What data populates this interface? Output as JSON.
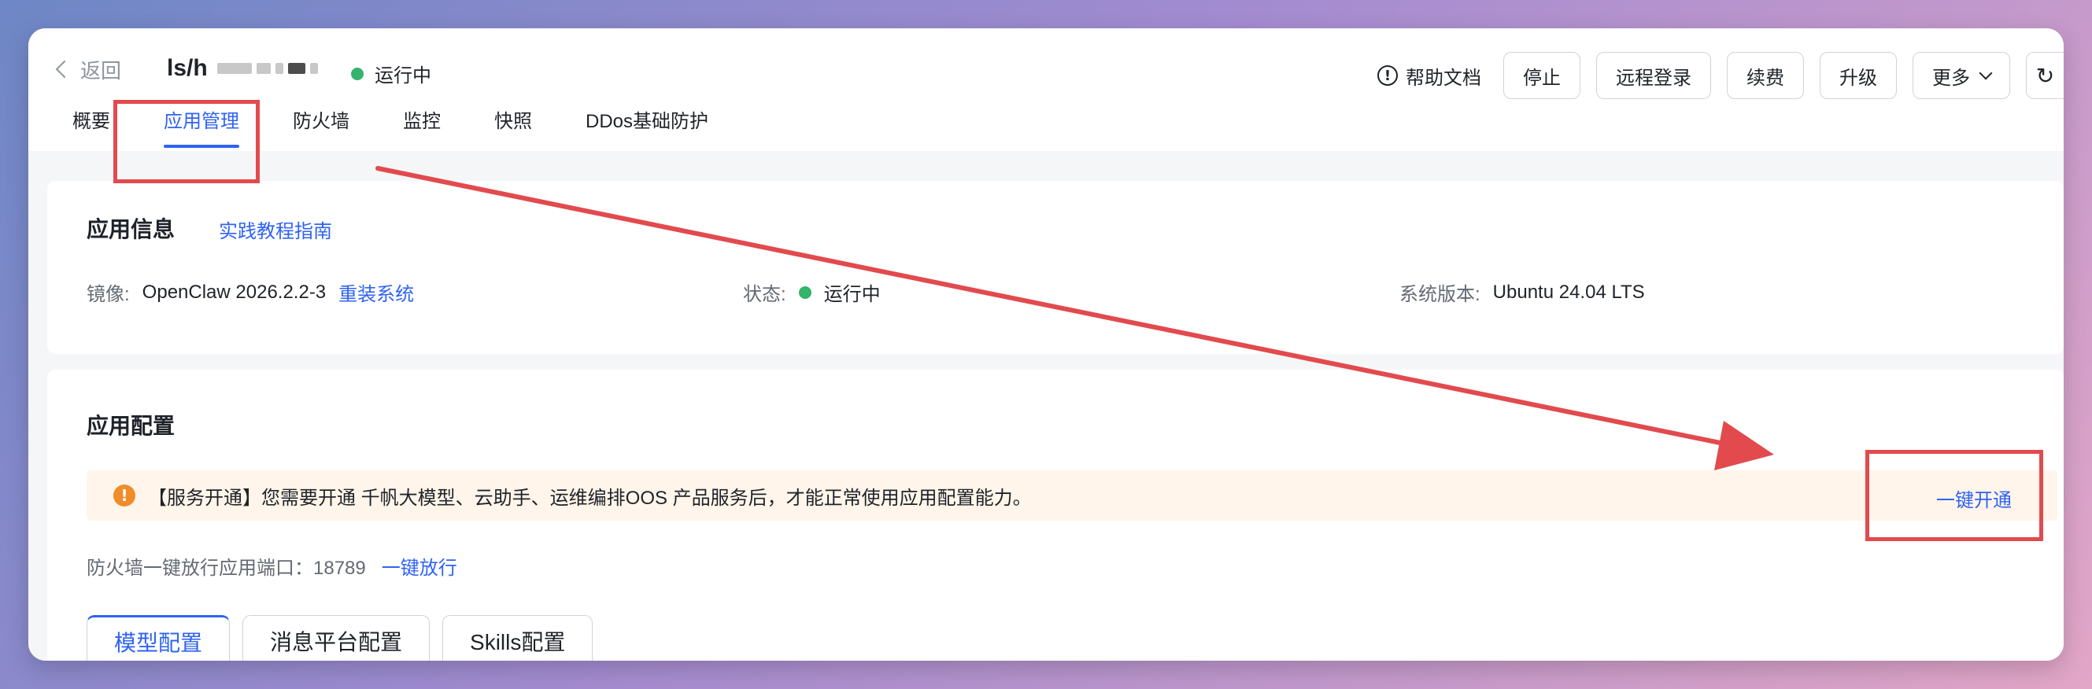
{
  "header": {
    "back_label": "返回",
    "instance_name": "ls/h",
    "status": "运行中",
    "actions": {
      "help_docs": "帮助文档",
      "stop": "停止",
      "remote_login": "远程登录",
      "renew": "续费",
      "upgrade": "升级",
      "more": "更多"
    }
  },
  "tabs": [
    {
      "label": "概要",
      "active": false
    },
    {
      "label": "应用管理",
      "active": true
    },
    {
      "label": "防火墙",
      "active": false
    },
    {
      "label": "监控",
      "active": false
    },
    {
      "label": "快照",
      "active": false
    },
    {
      "label": "DDos基础防护",
      "active": false
    }
  ],
  "app_info": {
    "title": "应用信息",
    "guide_link": "实践教程指南",
    "image_label": "镜像:",
    "image_value": "OpenClaw 2026.2.2-3",
    "reinstall_link": "重装系统",
    "status_label": "状态:",
    "status_value": "运行中",
    "os_label": "系统版本:",
    "os_value": "Ubuntu 24.04 LTS"
  },
  "app_config": {
    "title": "应用配置",
    "banner_text": "【服务开通】您需要开通 千帆大模型、云助手、运维编排OOS 产品服务后，才能正常使用应用配置能力。",
    "banner_action": "一键开通",
    "port_text": "防火墙一键放行应用端口：18789",
    "port_link": "一键放行",
    "config_tabs": [
      {
        "label": "模型配置",
        "active": true
      },
      {
        "label": "消息平台配置",
        "active": false
      },
      {
        "label": "Skills配置",
        "active": false
      }
    ]
  },
  "colors": {
    "accent": "#2f63f3",
    "status_green": "#34b36b",
    "warning_orange": "#f08c2a",
    "annotation_red": "#e24a4d"
  }
}
